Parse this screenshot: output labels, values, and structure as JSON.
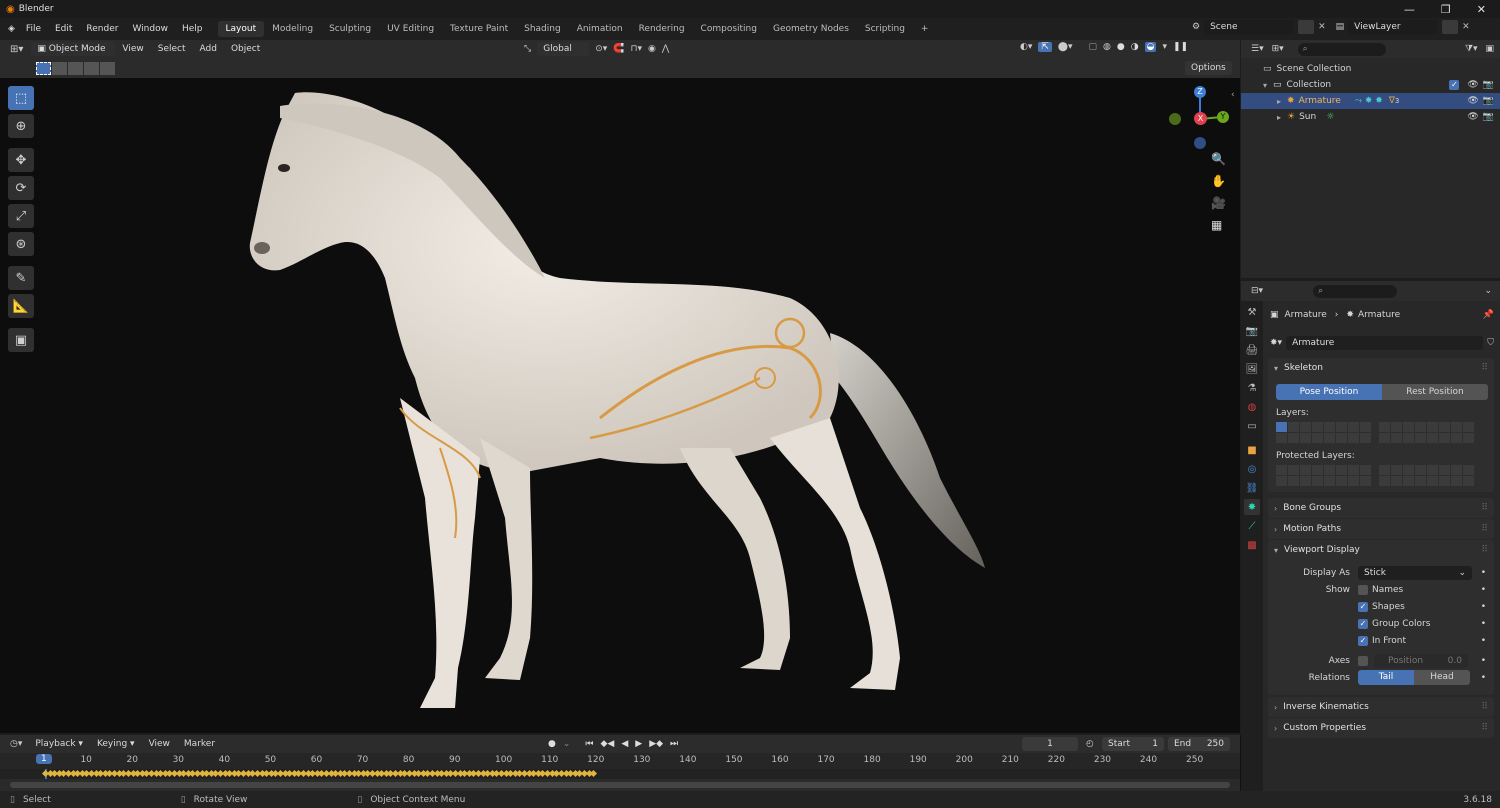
{
  "app": {
    "title": "Blender",
    "version": "3.6.18"
  },
  "menu": [
    "File",
    "Edit",
    "Render",
    "Window",
    "Help"
  ],
  "workspaces": [
    "Layout",
    "Modeling",
    "Sculpting",
    "UV Editing",
    "Texture Paint",
    "Shading",
    "Animation",
    "Rendering",
    "Compositing",
    "Geometry Nodes",
    "Scripting"
  ],
  "active_workspace": "Layout",
  "add_workspace": "+",
  "scene": {
    "name": "Scene",
    "view_layer": "ViewLayer"
  },
  "viewport_header": {
    "mode": "Object Mode",
    "menus": [
      "View",
      "Select",
      "Add",
      "Object"
    ],
    "orientation": "Global",
    "options": "Options"
  },
  "gizmo": {
    "z": "Z",
    "y": "Y",
    "x": "X"
  },
  "outliner": {
    "root": "Scene Collection",
    "collection": "Collection",
    "items": [
      {
        "name": "Armature",
        "selected": true,
        "badge": "3"
      },
      {
        "name": "Sun",
        "selected": false
      }
    ]
  },
  "properties": {
    "breadcrumb": [
      "Armature",
      "Armature"
    ],
    "data_name": "Armature",
    "skeleton": {
      "title": "Skeleton",
      "pose_position": "Pose Position",
      "rest_position": "Rest Position",
      "layers_label": "Layers:",
      "protected_layers_label": "Protected Layers:"
    },
    "bone_groups": "Bone Groups",
    "motion_paths": "Motion Paths",
    "viewport_display": {
      "title": "Viewport Display",
      "display_as_label": "Display As",
      "display_as_value": "Stick",
      "show_label": "Show",
      "names": "Names",
      "shapes": "Shapes",
      "group_colors": "Group Colors",
      "in_front": "In Front",
      "axes_label": "Axes",
      "position_label": "Position",
      "position_value": "0.0",
      "relations_label": "Relations",
      "tail": "Tail",
      "head": "Head"
    },
    "inverse_kinematics": "Inverse Kinematics",
    "custom_properties": "Custom Properties"
  },
  "timeline": {
    "menus": [
      "Playback",
      "Keying",
      "View",
      "Marker"
    ],
    "current_frame": "1",
    "start_label": "Start",
    "start": "1",
    "end_label": "End",
    "end": "250",
    "ticks": [
      "1",
      "10",
      "20",
      "30",
      "40",
      "50",
      "60",
      "70",
      "80",
      "90",
      "100",
      "110",
      "120",
      "130",
      "140",
      "150",
      "160",
      "170",
      "180",
      "190",
      "200",
      "210",
      "220",
      "230",
      "240",
      "250"
    ],
    "keyframe_start": 1,
    "keyframe_end": 120
  },
  "statusbar": {
    "select": "Select",
    "rotate": "Rotate View",
    "context": "Object Context Menu"
  },
  "colors": {
    "accent": "#4772b3",
    "armature_orange": "#e8a343",
    "gizmo_x": "#e0414f",
    "gizmo_y": "#6aa71e",
    "gizmo_z": "#3d7ed8",
    "keyframe": "#e2b43d"
  }
}
